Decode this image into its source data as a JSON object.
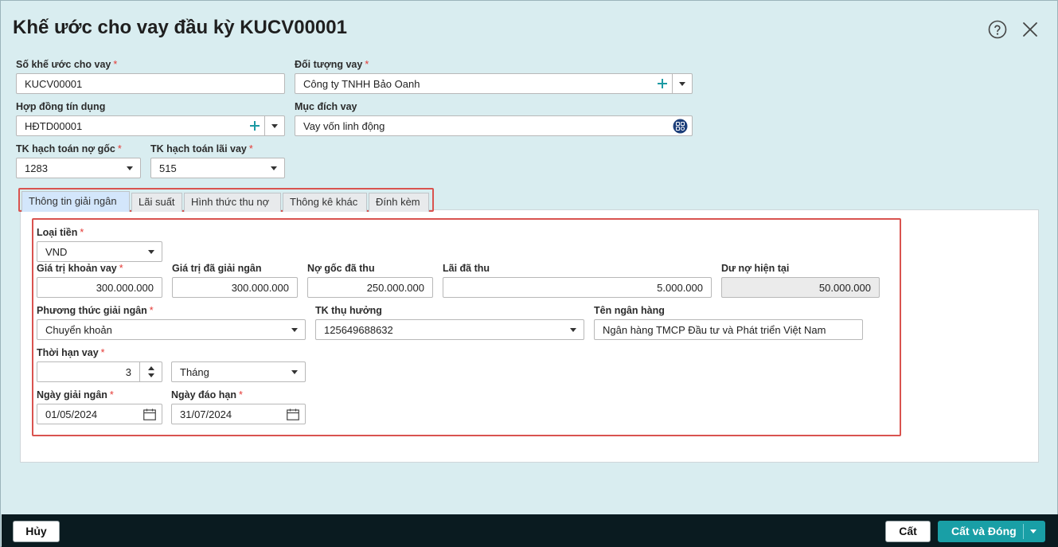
{
  "dialog": {
    "title": "Khế ước cho vay đầu kỳ KUCV00001"
  },
  "header": {
    "so_khe_uoc": {
      "label": "Số khế ước cho vay",
      "value": "KUCV00001"
    },
    "doi_tuong_vay": {
      "label": "Đối tượng vay",
      "value": "Công ty TNHH Bảo Oanh"
    },
    "hop_dong_tin_dung": {
      "label": "Hợp đồng tín dụng",
      "value": "HĐTD00001"
    },
    "muc_dich_vay": {
      "label": "Mục đích vay",
      "value": "Vay vốn linh động"
    },
    "tk_no_goc": {
      "label": "TK hạch toán nợ gốc",
      "value": "1283"
    },
    "tk_lai_vay": {
      "label": "TK hạch toán lãi vay",
      "value": "515"
    },
    "required_mark": "*"
  },
  "tabs": [
    {
      "label": "Thông tin giải ngân",
      "active": true
    },
    {
      "label": "Lãi suất",
      "active": false
    },
    {
      "label": "Hình thức thu nợ",
      "active": false
    },
    {
      "label": "Thông kê khác",
      "active": false
    },
    {
      "label": "Đính kèm",
      "active": false
    }
  ],
  "disbursement": {
    "loai_tien": {
      "label": "Loại tiền",
      "value": "VND"
    },
    "gia_tri_khoan_vay": {
      "label": "Giá trị khoản vay",
      "value": "300.000.000"
    },
    "gia_tri_da_giai_ngan": {
      "label": "Giá trị đã giải ngân",
      "value": "300.000.000"
    },
    "no_goc_da_thu": {
      "label": "Nợ gốc đã thu",
      "value": "250.000.000"
    },
    "lai_da_thu": {
      "label": "Lãi đã thu",
      "value": "5.000.000"
    },
    "du_no_hien_tai": {
      "label": "Dư nợ hiện tại",
      "value": "50.000.000"
    },
    "phuong_thuc_giai_ngan": {
      "label": "Phương thức giải ngân",
      "value": "Chuyển khoản"
    },
    "tk_thu_huong": {
      "label": "TK thụ hưởng",
      "value": "125649688632"
    },
    "ten_ngan_hang": {
      "label": "Tên ngân hàng",
      "value": "Ngân hàng TMCP Đầu tư và Phát triển Việt Nam"
    },
    "thoi_han_vay": {
      "label": "Thời hạn vay",
      "value": "3",
      "unit": "Tháng"
    },
    "ngay_giai_ngan": {
      "label": "Ngày giải ngân",
      "value": "01/05/2024"
    },
    "ngay_dao_han": {
      "label": "Ngày đáo hạn",
      "value": "31/07/2024"
    }
  },
  "footer": {
    "cancel_label": "Hủy",
    "save_label": "Cất",
    "save_close_label": "Cất và Đóng"
  },
  "colors": {
    "dialog_bg": "#d9edf0",
    "accent": "#199fa6",
    "highlight_border": "#d9534f",
    "footer_bg": "#0a1b20",
    "required": "#e53935"
  }
}
